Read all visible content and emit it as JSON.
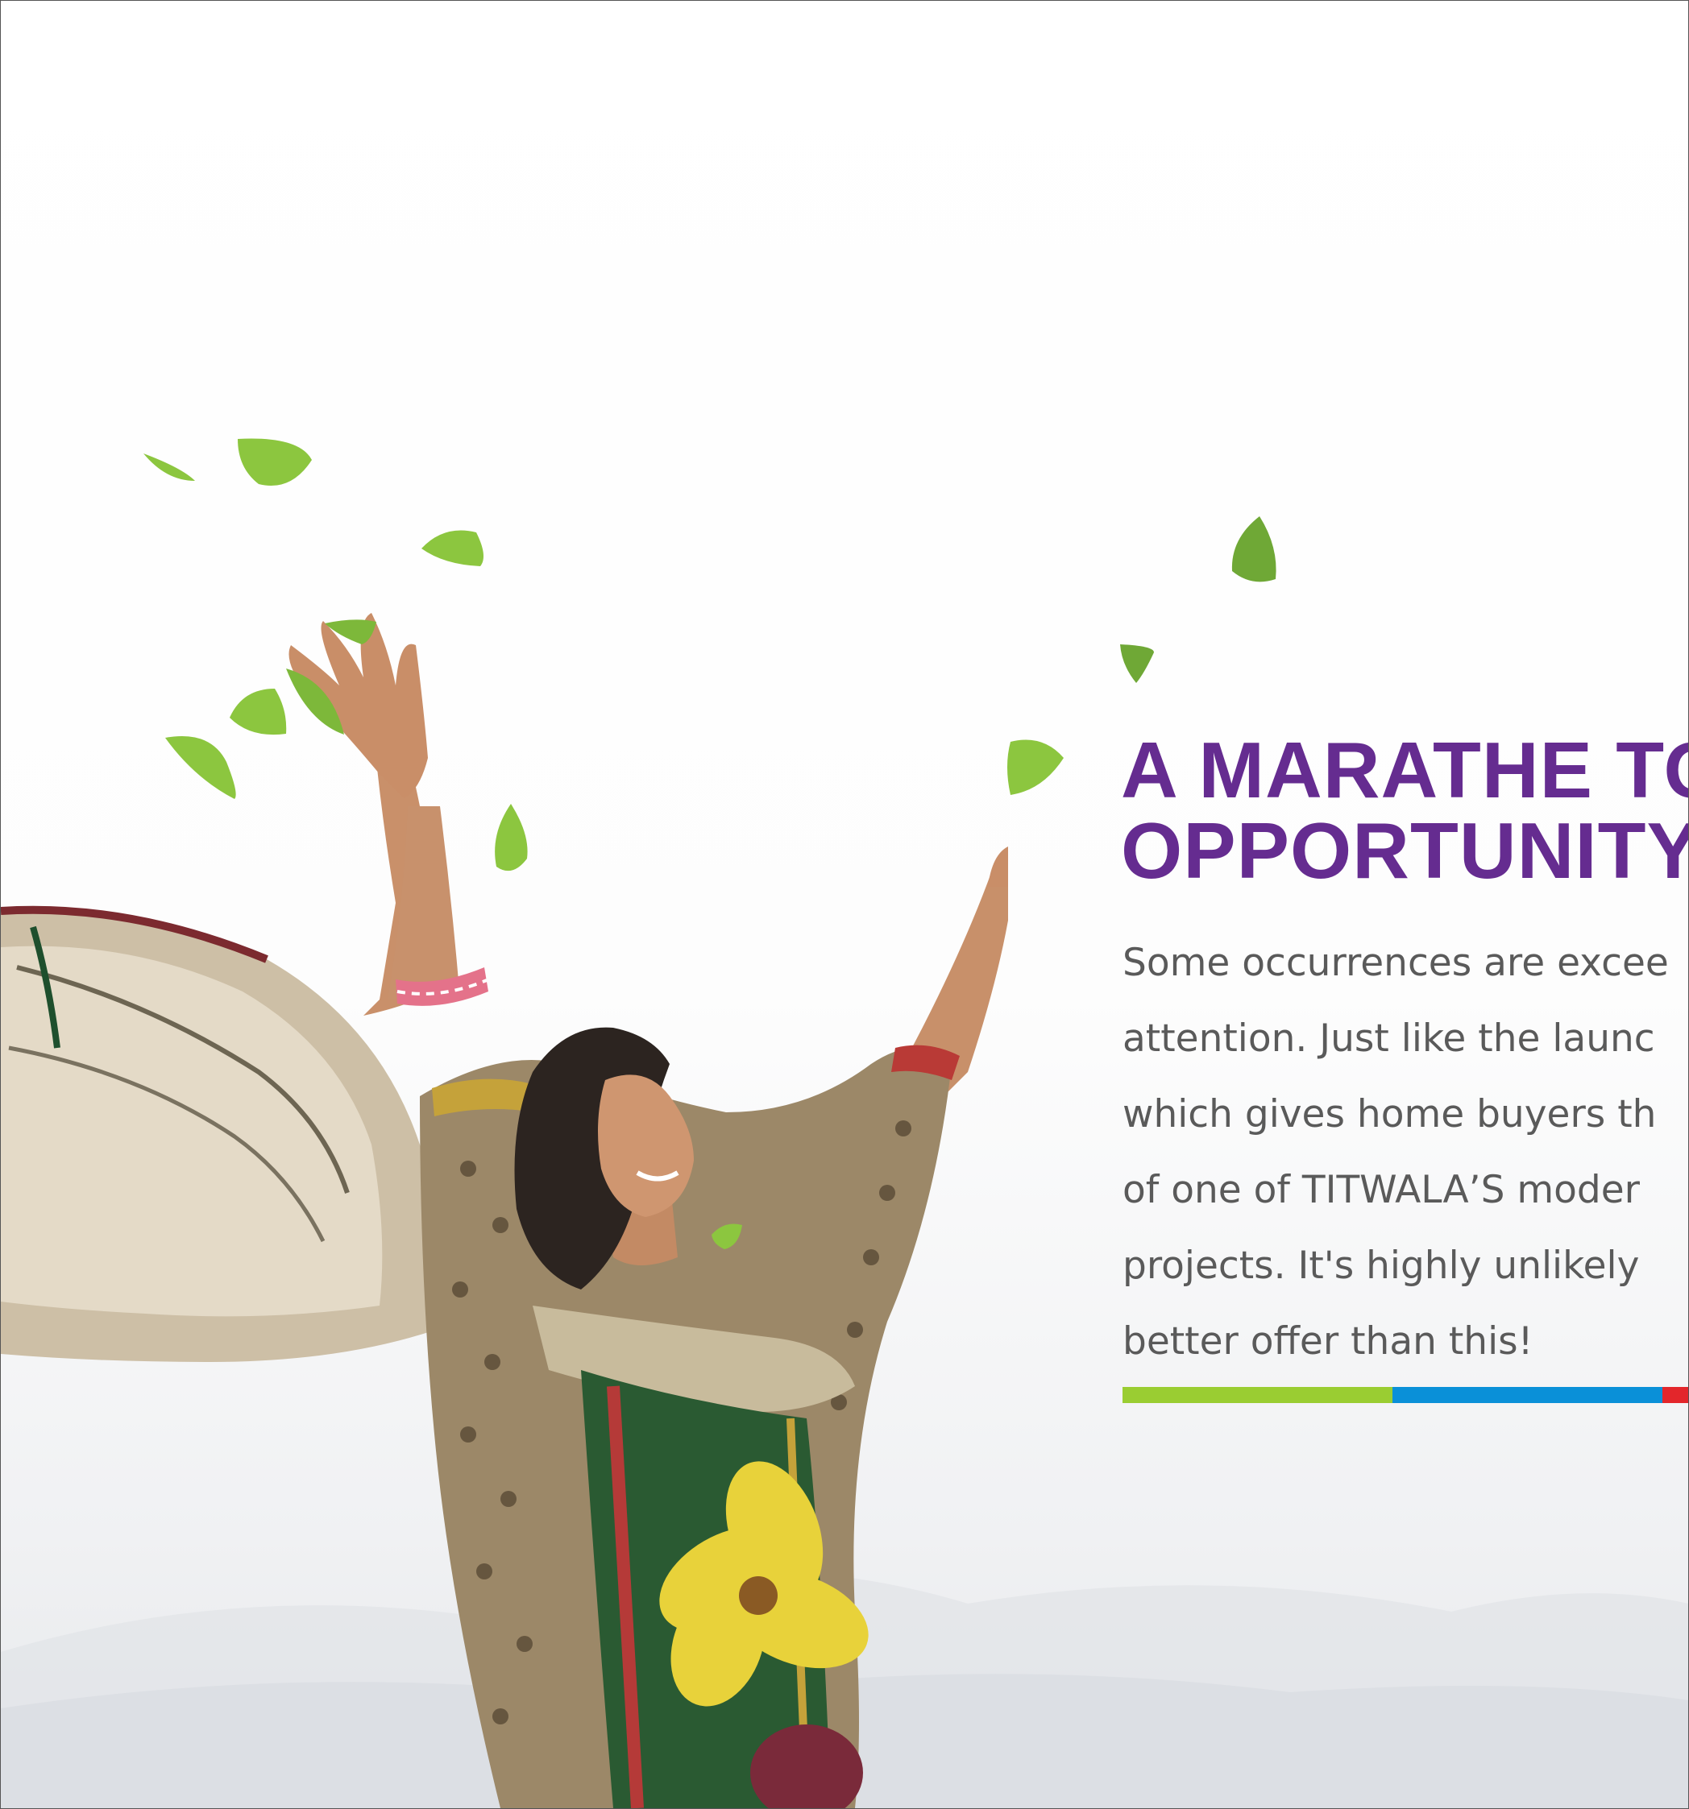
{
  "heading": {
    "line1": "A MARATHE TO",
    "line2": "OPPORTUNITY"
  },
  "body": {
    "lines": [
      "Some occurrences are excee",
      "attention. Just like the launc",
      "which gives home  buyers th",
      "of one of TITWALA’S moder",
      "projects. It's highly unlikely",
      "better offer than this!"
    ]
  },
  "colors": {
    "heading": "#652c90",
    "body_text": "#5a5a5a",
    "bar_green": "#9acd32",
    "bar_blue": "#0a90d8",
    "bar_red": "#e3262b",
    "leaf": "#8cc63f"
  },
  "decor": {
    "photo": "woman-raising-arms-with-flying-leaves",
    "icons": [
      "leaf-icon"
    ]
  }
}
